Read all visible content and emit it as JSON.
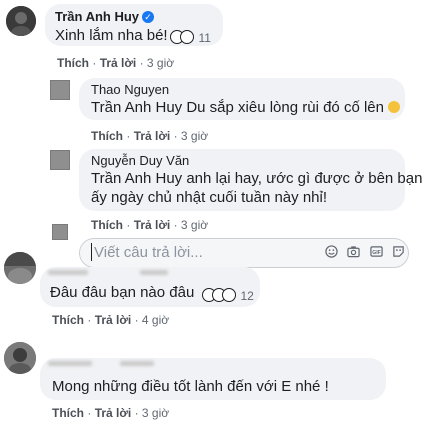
{
  "comments": [
    {
      "author": "Trần Anh Huy",
      "text": "Xinh lắm nha bé!",
      "reaction_count": "11",
      "like": "Thích",
      "reply": "Trả lời",
      "time": "3 giờ"
    },
    {
      "author": "Đâu đâu bạn nào đâu",
      "reaction_count": "12",
      "like": "Thích",
      "reply": "Trả lời",
      "time": "4 giờ"
    },
    {
      "text": "Mong những điều tốt lành đến với E nhé !",
      "like": "Thích",
      "reply": "Trả lời",
      "time": "3 giờ"
    }
  ],
  "replies": [
    {
      "author": "Thao Nguyen",
      "mention": "Trần Anh Huy",
      "text": "Du sắp xiêu lòng rùi đó cố lên",
      "like": "Thích",
      "reply": "Trả lời",
      "time": "3 giờ"
    },
    {
      "author": "Nguyễn Duy Văn",
      "mention": "Trần Anh Huy",
      "text_line1": "anh lại hay, ước gì được ở bên bạn",
      "text_line2": "ấy ngày chủ nhật cuối tuần này nhỉ!",
      "like": "Thích",
      "reply": "Trả lời",
      "time": "3 giờ"
    }
  ],
  "reply_input": {
    "placeholder": "Viết câu trả lời..."
  },
  "separator": "·",
  "colors": {
    "bubble": "#f0f2f5",
    "verified": "#1877f2",
    "meta_text": "#606770"
  }
}
